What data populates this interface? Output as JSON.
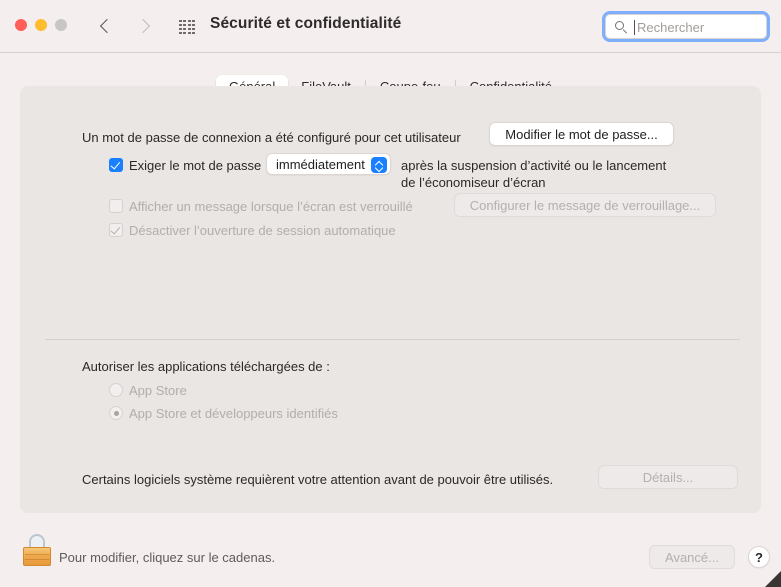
{
  "window": {
    "title": "Sécurité et confidentialité",
    "traffic_lights": [
      "close",
      "minimize",
      "zoom"
    ],
    "nav": {
      "back": "back-chevron",
      "forward": "forward-chevron"
    },
    "grid_icon": "apps-grid-icon"
  },
  "search": {
    "placeholder": "Rechercher",
    "value": "",
    "icon": "search-icon",
    "focused": true,
    "focus_ring_color": "#7eaffd"
  },
  "tabs": [
    {
      "label": "Général",
      "selected": true
    },
    {
      "label": "FileVault",
      "selected": false
    },
    {
      "label": "Coupe-feu",
      "selected": false
    },
    {
      "label": "Confidentialité",
      "selected": false
    }
  ],
  "general": {
    "password_status": "Un mot de passe de connexion a été configuré pour cet utilisateur",
    "change_password_button": "Modifier le mot de passe...",
    "require_password": {
      "checked": true,
      "label": "Exiger le mot de passe",
      "delay_value": "immédiatement",
      "suffix_line1": "après la suspension d’activité ou le lancement",
      "suffix_line2": "de l’économiseur d’écran"
    },
    "show_message": {
      "checked": false,
      "disabled": true,
      "label": "Afficher un message lorsque l’écran est verrouillé",
      "button": "Configurer le message de verrouillage..."
    },
    "disable_auto_login": {
      "checked": true,
      "disabled": true,
      "label": "Désactiver l’ouverture de session automatique"
    },
    "allow_apps": {
      "heading": "Autoriser les applications téléchargées de :",
      "options": [
        {
          "label": "App Store",
          "selected": false,
          "disabled": true
        },
        {
          "label": "App Store et développeurs identifiés",
          "selected": true,
          "disabled": true
        }
      ]
    },
    "software_notice": {
      "text": "Certains logiciels système requièrent votre attention avant de pouvoir être utilisés.",
      "button": "Détails...",
      "button_disabled": true
    }
  },
  "footer": {
    "lock_icon": "lock-closed-icon",
    "lock_text": "Pour modifier, cliquez sur le cadenas.",
    "advanced_button": "Avancé...",
    "advanced_disabled": true,
    "help_button": "?"
  },
  "colors": {
    "accent": "#1a80ff",
    "window_bg": "#f4efee",
    "panel_bg": "#eae6e4",
    "text": "#2b2827",
    "text_disabled": "#b3adac"
  }
}
